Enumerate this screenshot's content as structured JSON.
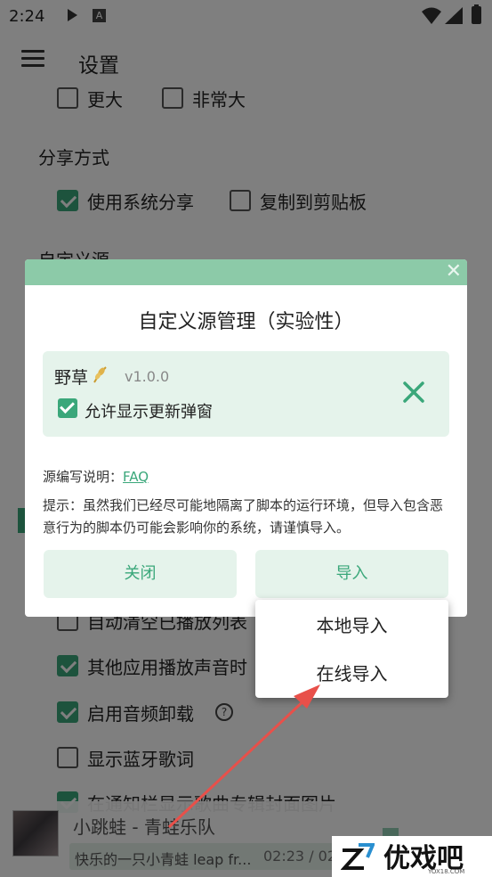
{
  "status_bar": {
    "time": "2:24",
    "notification_icon": "A"
  },
  "appbar": {
    "title": "设置"
  },
  "settings": {
    "font_size_opts": [
      "更大",
      "非常大"
    ],
    "share_title": "分享方式",
    "share_opts": [
      {
        "label": "使用系统分享",
        "checked": true
      },
      {
        "label": "复制到剪贴板",
        "checked": false
      }
    ],
    "custom_source_title": "自定义源",
    "toggles": [
      {
        "label": "自动清空已播放列表",
        "checked": false
      },
      {
        "label": "其他应用播放声音时",
        "checked": true
      },
      {
        "label": "启用音频卸载",
        "checked": true
      },
      {
        "label": "显示蓝牙歌词",
        "checked": false
      },
      {
        "label": "在通知栏显示歌曲专辑封面图片",
        "checked": true
      }
    ]
  },
  "dialog": {
    "title": "自定义源管理（实验性）",
    "source": {
      "name": "野草",
      "version": "v1.0.0",
      "allow_update_label": "允许显示更新弹窗",
      "allow_update": true
    },
    "help_prefix": "源编写说明：",
    "help_link": "FAQ",
    "tip": "提示：虽然我们已经尽可能地隔离了脚本的运行环境，但导入包含恶意行为的脚本仍可能会影响你的系统，请谨慎导入。",
    "close_label": "关闭",
    "import_label": "导入"
  },
  "import_menu": [
    "本地导入",
    "在线导入"
  ],
  "player": {
    "song": "小跳蛙 - 青蛙乐队",
    "lyric": "快乐的一只小青蛙 leap fr...",
    "time": "02:23 / 02"
  },
  "watermark": {
    "text": "优戏吧",
    "url": "YOX18.COM"
  },
  "colors": {
    "accent": "#3aa77a",
    "dialog_header": "#8ccaa8",
    "card_bg": "#e5f3eb",
    "arrow": "#e8504a"
  }
}
